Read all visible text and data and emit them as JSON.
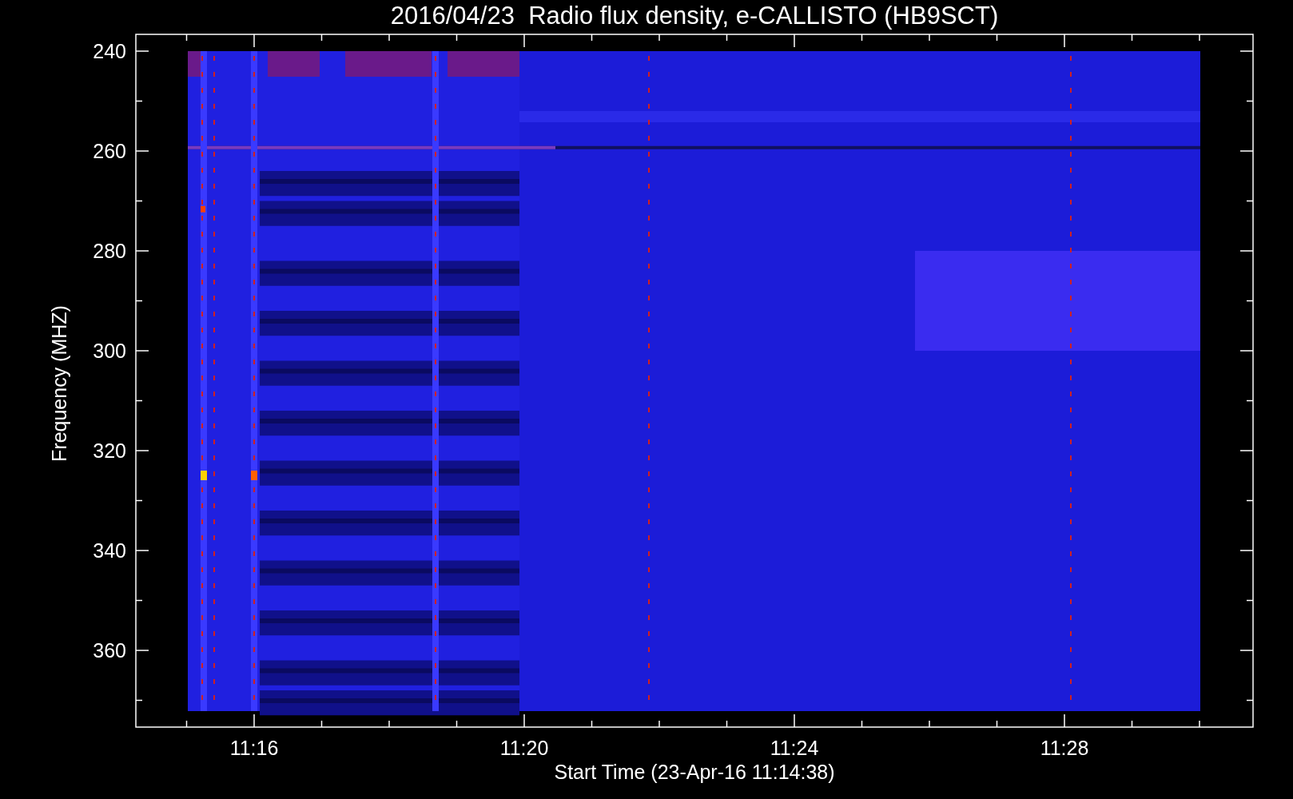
{
  "title": "2016/04/23  Radio flux density, e-CALLISTO (HB9SCT)",
  "y_axis": {
    "label": "Frequency (MHZ)",
    "ticks": [
      "240",
      "260",
      "280",
      "300",
      "320",
      "340",
      "360"
    ]
  },
  "x_axis": {
    "label": "Start Time (23-Apr-16 11:14:38)",
    "ticks": [
      "11:16",
      "11:20",
      "11:24",
      "11:28"
    ]
  }
}
